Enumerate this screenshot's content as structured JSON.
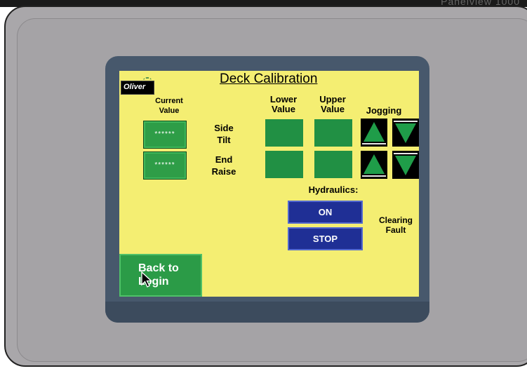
{
  "window": {
    "top_text": "Panelview 1000"
  },
  "screen": {
    "logo": "Oliver",
    "title": "Deck Calibration",
    "labels": {
      "current_value": "Current\nValue",
      "lower_value": "Lower\nValue",
      "upper_value": "Upper\nValue",
      "jogging": "Jogging",
      "side_tilt": "Side\nTilt",
      "end_raise": "End\nRaise",
      "hydraulics": "Hydraulics:",
      "clearing_fault": "Clearing\nFault"
    },
    "rows": [
      {
        "name": "side-tilt",
        "current_value": "******"
      },
      {
        "name": "end-raise",
        "current_value": "******"
      }
    ],
    "buttons": {
      "on": "ON",
      "stop": "STOP",
      "back_to_login_line1": "Back to",
      "back_to_login_line2": "Login"
    }
  },
  "colors": {
    "screen_bg": "#f4ee72",
    "button_green": "#2b9b47",
    "button_blue": "#1f2f95",
    "bezel": "#a9a7aa",
    "frame": "#47586c"
  },
  "icons": [
    "jog-up-icon",
    "jog-down-icon",
    "mouse-cursor-icon",
    "oliver-logo"
  ]
}
